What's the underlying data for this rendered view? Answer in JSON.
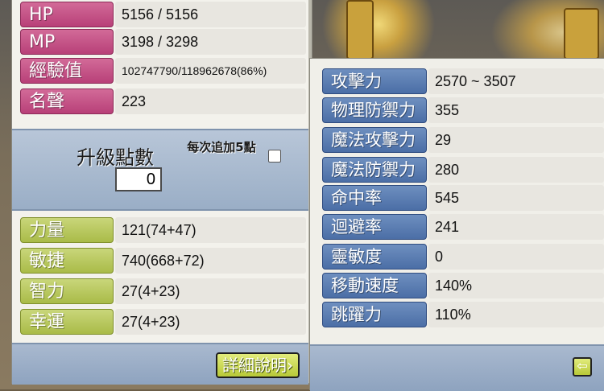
{
  "basic_stats": [
    {
      "label": "HP",
      "value": "5156 / 5156",
      "small": false
    },
    {
      "label": "MP",
      "value": "3198 / 3298",
      "small": false
    },
    {
      "label": "經驗值",
      "value": "102747790/118962678(86%)",
      "small": true
    },
    {
      "label": "名聲",
      "value": "223",
      "small": false
    }
  ],
  "ability_points": {
    "title": "升級點數",
    "value": "0",
    "auto_add_label": "每次追加5點"
  },
  "primary_stats": [
    {
      "label": "力量",
      "value": "121(74+47)"
    },
    {
      "label": "敏捷",
      "value": "740(668+72)"
    },
    {
      "label": "智力",
      "value": "27(4+23)"
    },
    {
      "label": "幸運",
      "value": "27(4+23)"
    }
  ],
  "detail_button": {
    "label": "詳細說明",
    "arrow": "›"
  },
  "detail_stats": [
    {
      "label": "攻擊力",
      "value": "2570 ~ 3507"
    },
    {
      "label": "物理防禦力",
      "value": "355"
    },
    {
      "label": "魔法攻擊力",
      "value": "29"
    },
    {
      "label": "魔法防禦力",
      "value": "280"
    },
    {
      "label": "命中率",
      "value": "545"
    },
    {
      "label": "迴避率",
      "value": "241"
    },
    {
      "label": "靈敏度",
      "value": "0"
    },
    {
      "label": "移動速度",
      "value": "140%"
    },
    {
      "label": "跳躍力",
      "value": "110%"
    }
  ],
  "back_button": {
    "icon": "back-arrow-icon",
    "glyph": "⇦"
  },
  "colors": {
    "pink_label": "#c24f86",
    "green_label": "#b3c352",
    "blue_label": "#5a7db2",
    "panel_bg": "#f3f2ec"
  }
}
